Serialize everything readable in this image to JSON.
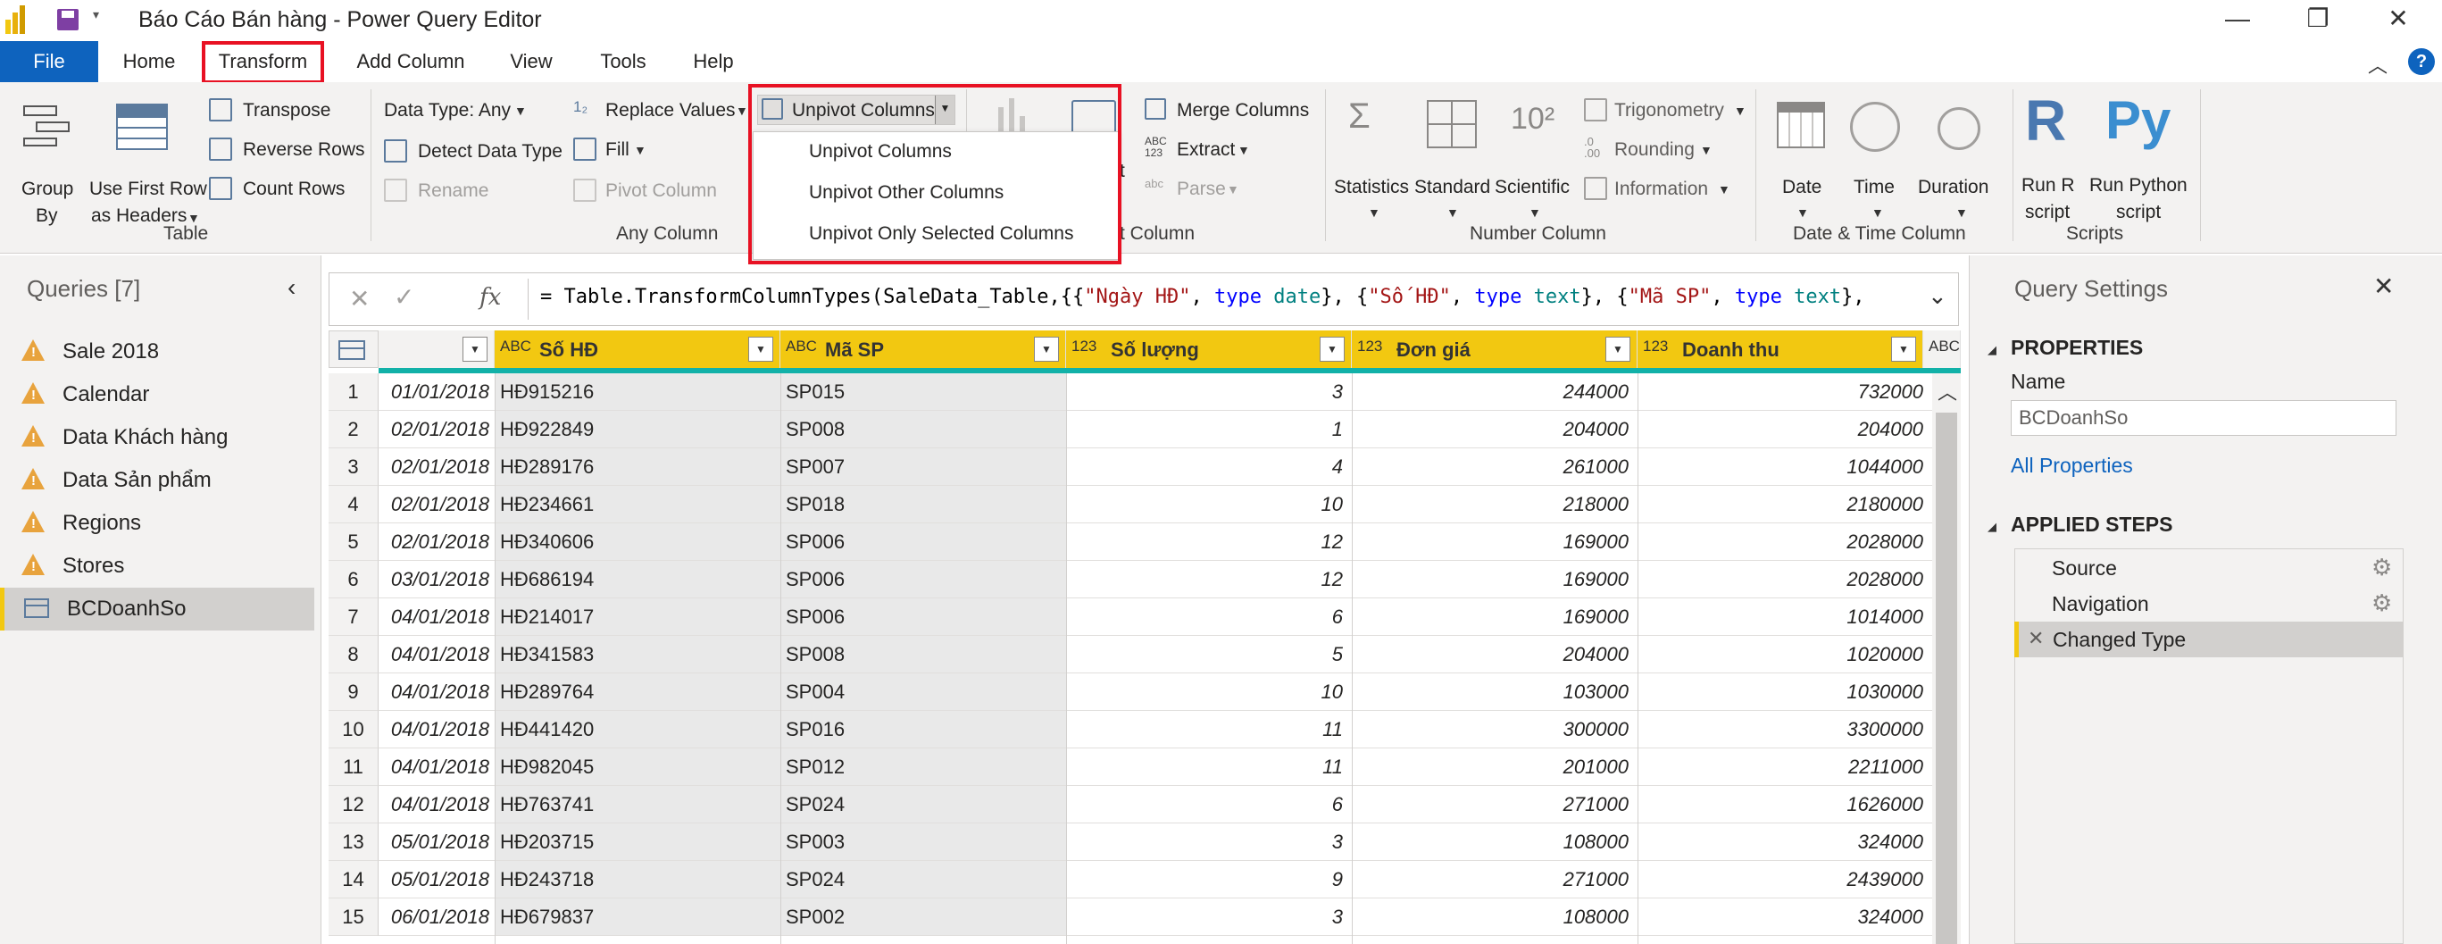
{
  "window": {
    "title": "Báo Cáo Bán hàng - Power Query Editor",
    "minimize": "—",
    "restore": "❐",
    "close": "✕"
  },
  "menu_tabs": [
    "File",
    "Home",
    "Transform",
    "Add Column",
    "View",
    "Tools",
    "Help"
  ],
  "ribbon": {
    "table": {
      "group_by": "Group\nBy",
      "group_by_1": "Group",
      "group_by_2": "By",
      "first_row_1": "Use First Row",
      "first_row_2": "as Headers",
      "transpose": "Transpose",
      "reverse_rows": "Reverse Rows",
      "count_rows": "Count Rows",
      "label": "Table"
    },
    "any_column": {
      "data_type": "Data Type: Any",
      "detect_type": "Detect Data Type",
      "rename": "Rename",
      "replace_values": "Replace Values",
      "fill": "Fill",
      "pivot_column": "Pivot Column",
      "unpivot_columns": "Unpivot Columns",
      "label": "Any Column"
    },
    "text_column": {
      "merge_columns": "Merge Columns",
      "extract": "Extract",
      "parse": "Parse",
      "label_partial": "t Column",
      "label_prefix_partial": "t"
    },
    "number_column": {
      "statistics": "Statistics",
      "standard": "Standard",
      "scientific": "Scientific",
      "trigonometry": "Trigonometry",
      "rounding": "Rounding",
      "information": "Information",
      "label": "Number Column"
    },
    "datetime": {
      "date": "Date",
      "time": "Time",
      "duration": "Duration",
      "label": "Date & Time Column"
    },
    "scripts": {
      "r_1": "Run R",
      "r_2": "script",
      "py_1": "Run Python",
      "py_2": "script",
      "label": "Scripts"
    }
  },
  "unpivot_menu": [
    "Unpivot Columns",
    "Unpivot Other Columns",
    "Unpivot Only Selected Columns"
  ],
  "queries": {
    "header": "Queries [7]",
    "items": [
      {
        "label": "Sale 2018",
        "warning": true
      },
      {
        "label": "Calendar",
        "warning": true
      },
      {
        "label": "Data Khách hàng",
        "warning": true
      },
      {
        "label": "Data Sản phẩm",
        "warning": true
      },
      {
        "label": "Regions",
        "warning": true
      },
      {
        "label": "Stores",
        "warning": true
      },
      {
        "label": "BCDoanhSo",
        "warning": false,
        "selected": true
      }
    ]
  },
  "formula_bar": {
    "cancel": "✕",
    "commit": "✓",
    "fx": "fx",
    "parts": [
      {
        "t": "= Table.TransformColumnTypes(SaleData_Table,{{",
        "c": "#000000"
      },
      {
        "t": "\"Ngày HĐ\"",
        "c": "#a31515"
      },
      {
        "t": ", ",
        "c": "#000000"
      },
      {
        "t": "type",
        "c": "#0000ff"
      },
      {
        "t": " date",
        "c": "#008080"
      },
      {
        "t": "}, {",
        "c": "#000000"
      },
      {
        "t": "\"Số HĐ\"",
        "c": "#a31515"
      },
      {
        "t": ", ",
        "c": "#000000"
      },
      {
        "t": "type",
        "c": "#0000ff"
      },
      {
        "t": " text",
        "c": "#008080"
      },
      {
        "t": "}, {",
        "c": "#000000"
      },
      {
        "t": "\"Mã SP\"",
        "c": "#a31515"
      },
      {
        "t": ", ",
        "c": "#000000"
      },
      {
        "t": "type",
        "c": "#0000ff"
      },
      {
        "t": " text",
        "c": "#008080"
      },
      {
        "t": "},",
        "c": "#000000"
      }
    ]
  },
  "table": {
    "columns": [
      {
        "type": "",
        "name": ""
      },
      {
        "type": "ABC",
        "name": "Số HĐ"
      },
      {
        "type": "ABC",
        "name": "Mã SP"
      },
      {
        "type": "123",
        "name": "Số lượng"
      },
      {
        "type": "123",
        "name": "Đơn giá"
      },
      {
        "type": "123",
        "name": "Doanh thu"
      },
      {
        "type": "ABC",
        "name": ""
      }
    ],
    "rows": [
      [
        "1",
        "01/01/2018",
        "HĐ915216",
        "SP015",
        "3",
        "244000",
        "732000"
      ],
      [
        "2",
        "02/01/2018",
        "HĐ922849",
        "SP008",
        "1",
        "204000",
        "204000"
      ],
      [
        "3",
        "02/01/2018",
        "HĐ289176",
        "SP007",
        "4",
        "261000",
        "1044000"
      ],
      [
        "4",
        "02/01/2018",
        "HĐ234661",
        "SP018",
        "10",
        "218000",
        "2180000"
      ],
      [
        "5",
        "02/01/2018",
        "HĐ340606",
        "SP006",
        "12",
        "169000",
        "2028000"
      ],
      [
        "6",
        "03/01/2018",
        "HĐ686194",
        "SP006",
        "12",
        "169000",
        "2028000"
      ],
      [
        "7",
        "04/01/2018",
        "HĐ214017",
        "SP006",
        "6",
        "169000",
        "1014000"
      ],
      [
        "8",
        "04/01/2018",
        "HĐ341583",
        "SP008",
        "5",
        "204000",
        "1020000"
      ],
      [
        "9",
        "04/01/2018",
        "HĐ289764",
        "SP004",
        "10",
        "103000",
        "1030000"
      ],
      [
        "10",
        "04/01/2018",
        "HĐ441420",
        "SP016",
        "11",
        "300000",
        "3300000"
      ],
      [
        "11",
        "04/01/2018",
        "HĐ982045",
        "SP012",
        "11",
        "201000",
        "2211000"
      ],
      [
        "12",
        "04/01/2018",
        "HĐ763741",
        "SP024",
        "6",
        "271000",
        "1626000"
      ],
      [
        "13",
        "05/01/2018",
        "HĐ203715",
        "SP003",
        "3",
        "108000",
        "324000"
      ],
      [
        "14",
        "05/01/2018",
        "HĐ243718",
        "SP024",
        "9",
        "271000",
        "2439000"
      ],
      [
        "15",
        "06/01/2018",
        "HĐ679837",
        "SP002",
        "3",
        "108000",
        "324000"
      ]
    ]
  },
  "query_settings": {
    "title": "Query Settings",
    "properties": "PROPERTIES",
    "name_label": "Name",
    "name_value": "BCDoanhSo",
    "all_properties": "All Properties",
    "applied_steps": "APPLIED STEPS",
    "steps": [
      {
        "label": "Source",
        "gear": true
      },
      {
        "label": "Navigation",
        "gear": true
      },
      {
        "label": "Changed Type",
        "gear": false,
        "selected": true
      }
    ]
  },
  "colors": {
    "file_tab": "#0e63be",
    "header_yellow": "#f2c811",
    "highlight_red": "#e81123",
    "link_blue": "#0e63be",
    "warning": "#e8a33d"
  }
}
